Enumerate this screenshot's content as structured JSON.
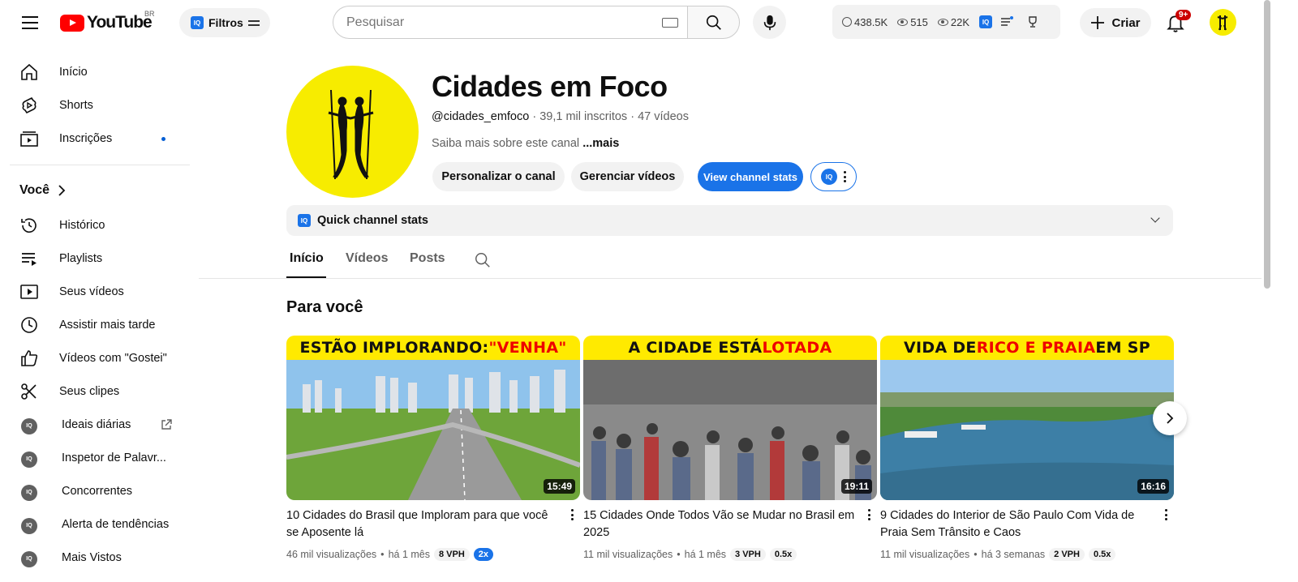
{
  "header": {
    "logo_text": "YouTube",
    "country_code": "BR",
    "filter_label": "Filtros",
    "iq_badge": "IQ",
    "search_placeholder": "Pesquisar",
    "stats": [
      {
        "icon": "clock-icon",
        "value": "438.5K"
      },
      {
        "icon": "eye-icon",
        "value": "515"
      },
      {
        "icon": "eye-icon",
        "value": "22K"
      }
    ],
    "create_label": "Criar",
    "notif_badge": "9+"
  },
  "sidebar": {
    "main": [
      {
        "icon": "home-icon",
        "label": "Início"
      },
      {
        "icon": "shorts-icon",
        "label": "Shorts"
      },
      {
        "icon": "subscriptions-icon",
        "label": "Inscrições",
        "has_dot": true
      }
    ],
    "you_section_title": "Você",
    "you": [
      {
        "icon": "history-icon",
        "label": "Histórico"
      },
      {
        "icon": "playlists-icon",
        "label": "Playlists"
      },
      {
        "icon": "your-videos-icon",
        "label": "Seus vídeos"
      },
      {
        "icon": "watch-later-icon",
        "label": "Assistir mais tarde"
      },
      {
        "icon": "like-icon",
        "label": "Vídeos com \"Gostei\""
      },
      {
        "icon": "clips-icon",
        "label": "Seus clipes"
      },
      {
        "icon": "iq-icon",
        "label": "Ideais diárias",
        "external": true
      },
      {
        "icon": "iq-icon",
        "label": "Inspetor de Palavr..."
      },
      {
        "icon": "iq-icon",
        "label": "Concorrentes"
      },
      {
        "icon": "iq-icon",
        "label": "Alerta de tendências"
      },
      {
        "icon": "iq-icon",
        "label": "Mais Vistos"
      }
    ]
  },
  "channel": {
    "name": "Cidades em Foco",
    "handle": "@cidades_emfoco",
    "subscribers": "39,1 mil inscritos",
    "videos_count": "47 vídeos",
    "about_text": "Saiba mais sobre este canal",
    "about_more": "...mais",
    "customize_label": "Personalizar o canal",
    "manage_label": "Gerenciar vídeos",
    "stats_btn_label": "View channel stats",
    "quick_stats_label": "Quick channel stats",
    "accent": "#1a73e8",
    "avatar_bg": "#f7ec00"
  },
  "tabs": [
    {
      "label": "Início",
      "active": true
    },
    {
      "label": "Vídeos"
    },
    {
      "label": "Posts"
    }
  ],
  "section_title": "Para você",
  "videos": [
    {
      "banner_a": "ESTÃO IMPLORANDO: ",
      "banner_b": "\"VENHA\"",
      "banner_c": "",
      "duration": "15:49",
      "title": "10 Cidades do Brasil que Imploram para que você se Aposente lá",
      "views": "46 mil visualizações",
      "age": "há 1 mês",
      "vph": "8 VPH",
      "multiplier": "2x",
      "multiplier_blue": true
    },
    {
      "banner_a": "A CIDADE ESTÁ ",
      "banner_b": "LOTADA",
      "banner_c": "",
      "duration": "19:11",
      "title": "15 Cidades Onde Todos Vão se Mudar no Brasil em 2025",
      "views": "11 mil visualizações",
      "age": "há 1 mês",
      "vph": "3 VPH",
      "multiplier": "0.5x",
      "multiplier_blue": false
    },
    {
      "banner_a": "VIDA DE ",
      "banner_b": "RICO E PRAIA",
      "banner_c": " EM SP",
      "duration": "16:16",
      "title": "9 Cidades do Interior de São Paulo Com Vida de Praia Sem Trânsito e Caos",
      "views": "11 mil visualizações",
      "age": "há 3 semanas",
      "vph": "2 VPH",
      "multiplier": "0.5x",
      "multiplier_blue": false
    }
  ]
}
